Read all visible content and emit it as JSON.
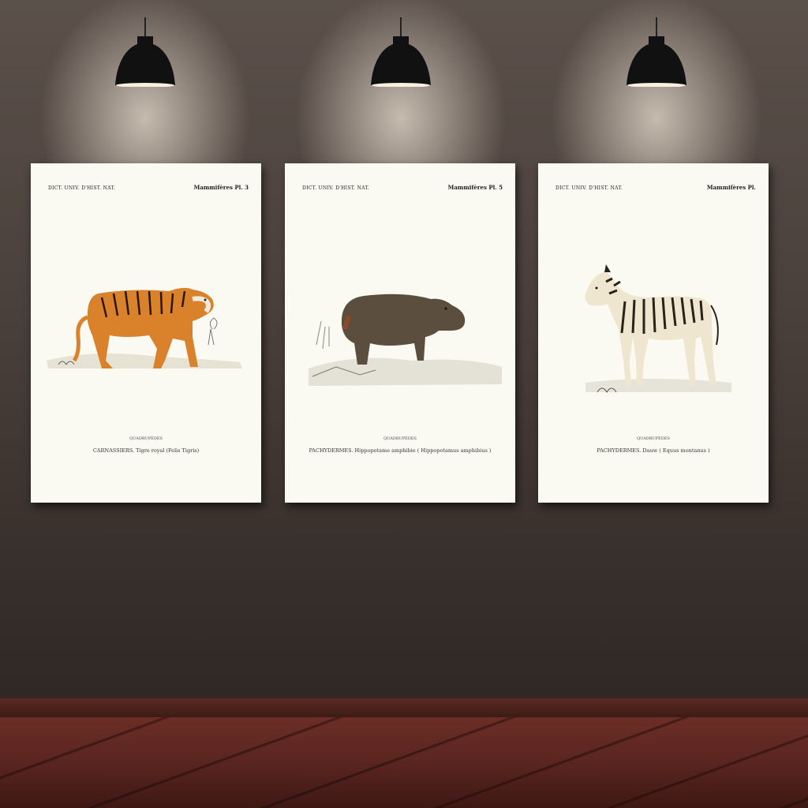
{
  "posters": [
    {
      "header_left": "DICT. UNIV. D'HIST. NAT.",
      "header_right": "Mammifères Pl. 3",
      "animal": "tiger-illustration",
      "caption_small": "QUADRUPÈDES",
      "caption_main": "CARNASSIERS. Tigre royal (Felis Tigris)",
      "signature": ""
    },
    {
      "header_left": "DICT. UNIV. D'HIST. NAT.",
      "header_right": "Mammifères Pl. 5",
      "animal": "hippopotamus-illustration",
      "caption_small": "QUADRUPÈDES",
      "caption_main": "PACHYDERMES. Hippopotame amphibie ( Hippopotamus amphibius )",
      "signature": ""
    },
    {
      "header_left": "DICT. UNIV. D'HIST. NAT.",
      "header_right": "Mammifères Pl.",
      "animal": "zebra-illustration",
      "caption_small": "QUADRUPÈDES",
      "caption_main": "PACHYDERMES. Dauw ( Equus montanus )",
      "signature": ""
    }
  ],
  "colors": {
    "wall": "#4a403b",
    "poster_paper": "#fbfaf2",
    "floor": "#5a2520",
    "tiger": "#d9822b",
    "hippo": "#5b4e3e"
  }
}
